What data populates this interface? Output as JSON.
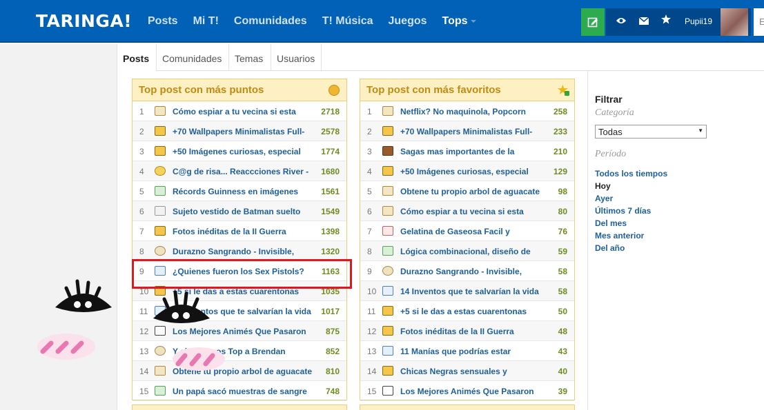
{
  "header": {
    "logo": "TARINGA!",
    "nav": [
      {
        "label": "Posts",
        "active": false
      },
      {
        "label": "Mi T!",
        "active": false
      },
      {
        "label": "Comunidades",
        "active": false
      },
      {
        "label": "T! Música",
        "active": false
      },
      {
        "label": "Juegos",
        "active": false
      },
      {
        "label": "Tops",
        "active": true
      }
    ],
    "username": "Pupii19",
    "search_partial": "E",
    "icons": [
      "new-post-icon",
      "eye-icon",
      "mail-icon",
      "star-icon"
    ]
  },
  "tabs": [
    "Posts",
    "Comunidades",
    "Temas",
    "Usuarios"
  ],
  "panel_points": {
    "title": "Top post con más puntos",
    "rows": [
      {
        "n": "1",
        "icon": "chart",
        "title": "Cómo espiar a tu vecina si esta",
        "pts": "2718"
      },
      {
        "n": "2",
        "icon": "image",
        "title": "+70 Wallpapers Minimalistas Full-",
        "pts": "2578"
      },
      {
        "n": "3",
        "icon": "image",
        "title": "+50 Imágenes curiosas, especial",
        "pts": "1774"
      },
      {
        "n": "4",
        "icon": "smiley",
        "title": "C@g de risa... Reaccciones River -",
        "pts": "1680"
      },
      {
        "n": "5",
        "icon": "flask",
        "title": "Récords Guinness en imágenes",
        "pts": "1561"
      },
      {
        "n": "6",
        "icon": "doc",
        "title": "Sujeto vestido de Batman suelto",
        "pts": "1549"
      },
      {
        "n": "7",
        "icon": "image",
        "title": "Fotos inéditas de la II Guerra",
        "pts": "1398"
      },
      {
        "n": "8",
        "icon": "bubble",
        "title": "Durazno Sangrando - Invisible,",
        "pts": "1320"
      },
      {
        "n": "9",
        "icon": "book",
        "title": "¿Quienes fueron los Sex Pistols?",
        "pts": "1163"
      },
      {
        "n": "10",
        "icon": "image",
        "title": "+5 si le das a estas cuarentonas",
        "pts": "1035"
      },
      {
        "n": "11",
        "icon": "book",
        "title": "14 Inventos que te salvarían la vida",
        "pts": "1017"
      },
      {
        "n": "12",
        "icon": "anime",
        "title": "Los Mejores Animés Que Pasaron",
        "pts": "875"
      },
      {
        "n": "13",
        "icon": "bubble",
        "title": "Y el ganamos Top a Brendan",
        "pts": "852"
      },
      {
        "n": "14",
        "icon": "chart",
        "title": "Obtene tu propio arbol de aguacate",
        "pts": "810"
      },
      {
        "n": "15",
        "icon": "flask",
        "title": "Un papá sacó muestras de sangre",
        "pts": "748"
      }
    ]
  },
  "panel_favs": {
    "title": "Top post con más favoritos",
    "rows": [
      {
        "n": "1",
        "icon": "chart",
        "title": "Netflix? No maquinola, Popcorn",
        "pts": "258"
      },
      {
        "n": "2",
        "icon": "image",
        "title": "+70 Wallpapers Minimalistas Full-",
        "pts": "233"
      },
      {
        "n": "3",
        "icon": "bookbrown",
        "title": "Sagas mas importantes de la",
        "pts": "210"
      },
      {
        "n": "4",
        "icon": "image",
        "title": "+50 Imágenes curiosas, especial",
        "pts": "129"
      },
      {
        "n": "5",
        "icon": "chart",
        "title": "Obtene tu propio arbol de aguacate",
        "pts": "98"
      },
      {
        "n": "6",
        "icon": "chart",
        "title": "Cómo espiar a tu vecina si esta",
        "pts": "80"
      },
      {
        "n": "7",
        "icon": "cake",
        "title": "Gelatina de Gaseosa Facil y",
        "pts": "76"
      },
      {
        "n": "8",
        "icon": "flask",
        "title": "Lógica combinacional, diseño de",
        "pts": "59"
      },
      {
        "n": "9",
        "icon": "bubble",
        "title": "Durazno Sangrando - Invisible,",
        "pts": "58"
      },
      {
        "n": "10",
        "icon": "book",
        "title": "14 Inventos que te salvarían la vida",
        "pts": "58"
      },
      {
        "n": "11",
        "icon": "image",
        "title": "+5 si le das a estas cuarentonas",
        "pts": "50"
      },
      {
        "n": "12",
        "icon": "image",
        "title": "Fotos inéditas de la II Guerra",
        "pts": "48"
      },
      {
        "n": "13",
        "icon": "book",
        "title": "11 Manías que podrías estar",
        "pts": "43"
      },
      {
        "n": "14",
        "icon": "image",
        "title": "Chicas Negras sensuales y",
        "pts": "40"
      },
      {
        "n": "15",
        "icon": "anime",
        "title": "Los Mejores Animés Que Pasaron",
        "pts": "39"
      }
    ]
  },
  "filter": {
    "title": "Filtrar",
    "category_label": "Categoría",
    "category_value": "Todas",
    "period_label": "Período",
    "periods": [
      {
        "label": "Todos los tiempos",
        "selected": false
      },
      {
        "label": "Hoy",
        "selected": true
      },
      {
        "label": "Ayer",
        "selected": false
      },
      {
        "label": "Últimos 7 días",
        "selected": false
      },
      {
        "label": "Del mes",
        "selected": false
      },
      {
        "label": "Mes anterior",
        "selected": false
      },
      {
        "label": "Del año",
        "selected": false
      }
    ]
  },
  "colors": {
    "header_blue": "#0061b7",
    "panel_title_bg": "#fdf1c4",
    "panel_title_text": "#c18a12",
    "link_blue": "#1f5f9a",
    "points_green": "#6e8c22",
    "highlight_red": "#e3161f"
  }
}
